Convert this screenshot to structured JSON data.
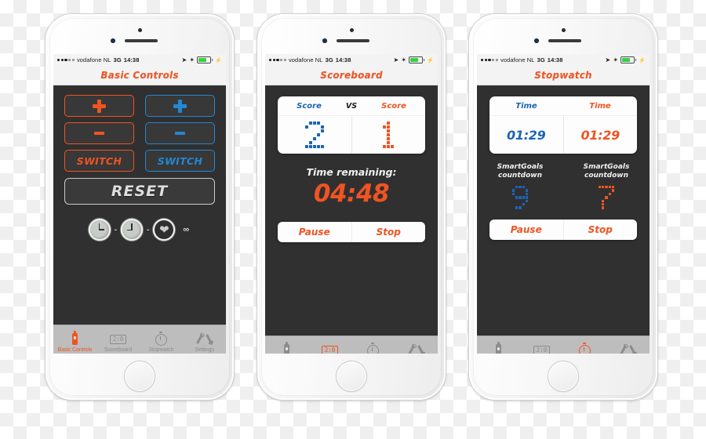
{
  "statusbar": {
    "signal_dots_filled": 3,
    "signal_dots_empty": 2,
    "carrier": "vodafone NL",
    "network": "3G",
    "time": "14:38",
    "location_icon": "location-arrow-icon",
    "bluetooth_icon": "bluetooth-icon",
    "battery_icon": "battery-icon",
    "charging_icon": "lightning-bolt-icon"
  },
  "tabs": [
    {
      "label": "Basic Controls",
      "icon": "bottle-icon"
    },
    {
      "label": "Scoreboard",
      "icon": "scoreboard-icon",
      "icon_text": "2:0"
    },
    {
      "label": "Stopwatch",
      "icon": "stopwatch-icon"
    },
    {
      "label": "Settings",
      "icon": "tools-icon"
    }
  ],
  "phones": [
    {
      "title": "Basic Controls",
      "active_tab": 0,
      "controls": {
        "plus_left": "+",
        "plus_right": "+",
        "minus_left": "-",
        "minus_right": "-",
        "switch_left": "SWITCH",
        "switch_right": "SWITCH",
        "reset": "RESET",
        "left_color": "#ef5423",
        "right_color": "#2387d1"
      },
      "status_row": {
        "icon1": "clock-icon",
        "sep1": "-",
        "icon2": "clock-icon",
        "sep2": "-",
        "icon3": "heart-icon",
        "infinity": "∞"
      }
    },
    {
      "title": "Scoreboard",
      "active_tab": 1,
      "card": {
        "head_left": "Score",
        "head_mid": "VS",
        "head_right": "Score",
        "value_left": "2",
        "value_right": "1",
        "left_color": "#1d64b8",
        "right_color": "#ef5423"
      },
      "time_remaining_label": "Time remaining:",
      "time_remaining_value": "04:48",
      "buttons": {
        "pause": "Pause",
        "stop": "Stop"
      }
    },
    {
      "title": "Stopwatch",
      "active_tab": 2,
      "card": {
        "head_left": "Time",
        "head_right": "Time",
        "value_left": "01:29",
        "value_right": "01:29",
        "left_color": "#1d64b8",
        "right_color": "#ef5423"
      },
      "countdown": {
        "label_left_line1": "SmartGoals",
        "label_left_line2": "countdown",
        "label_right_line1": "SmartGoals",
        "label_right_line2": "countdown",
        "digit_left": "9",
        "digit_right": "7"
      },
      "buttons": {
        "pause": "Pause",
        "stop": "Stop"
      }
    }
  ]
}
